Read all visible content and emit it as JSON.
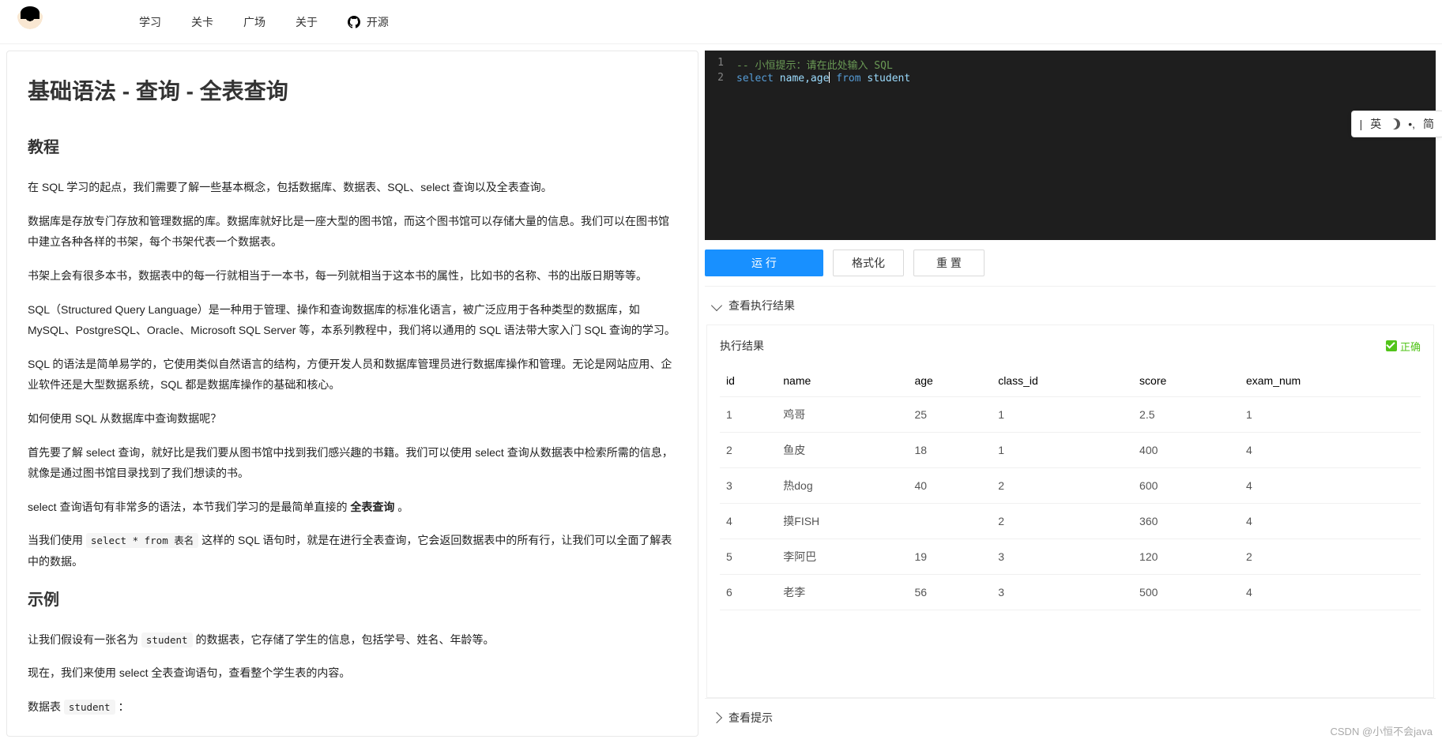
{
  "nav": {
    "items": [
      "学习",
      "关卡",
      "广场",
      "关于"
    ],
    "opensource": "开源"
  },
  "article": {
    "title": "基础语法 - 查询 - 全表查询",
    "h_tutorial": "教程",
    "p1": "在 SQL 学习的起点，我们需要了解一些基本概念，包括数据库、数据表、SQL、select 查询以及全表查询。",
    "p2": "数据库是存放专门存放和管理数据的库。数据库就好比是一座大型的图书馆，而这个图书馆可以存储大量的信息。我们可以在图书馆中建立各种各样的书架，每个书架代表一个数据表。",
    "p3": "书架上会有很多本书，数据表中的每一行就相当于一本书，每一列就相当于这本书的属性，比如书的名称、书的出版日期等等。",
    "p4": "SQL（Structured Query Language）是一种用于管理、操作和查询数据库的标准化语言，被广泛应用于各种类型的数据库，如 MySQL、PostgreSQL、Oracle、Microsoft SQL Server 等，本系列教程中，我们将以通用的 SQL 语法带大家入门 SQL 查询的学习。",
    "p5": "SQL 的语法是简单易学的，它使用类似自然语言的结构，方便开发人员和数据库管理员进行数据库操作和管理。无论是网站应用、企业软件还是大型数据系统，SQL 都是数据库操作的基础和核心。",
    "p6": "如何使用 SQL 从数据库中查询数据呢？",
    "p7": "首先要了解 select 查询，就好比是我们要从图书馆中找到我们感兴趣的书籍。我们可以使用 select 查询从数据表中检索所需的信息，就像是通过图书馆目录找到了我们想读的书。",
    "p8_pre": "select 查询语句有非常多的语法，本节我们学习的是最简单直接的 ",
    "p8_bold": "全表查询",
    "p8_post": " 。",
    "p9_pre": "当我们使用 ",
    "p9_code": "select * from 表名",
    "p9_post": " 这样的 SQL 语句时，就是在进行全表查询，它会返回数据表中的所有行，让我们可以全面了解表中的数据。",
    "h_example": "示例",
    "p10_pre": "让我们假设有一张名为 ",
    "p10_code": "student",
    "p10_post": " 的数据表，它存储了学生的信息，包括学号、姓名、年龄等。",
    "p11": "现在，我们来使用 select 全表查询语句，查看整个学生表的内容。",
    "p12_pre": "数据表 ",
    "p12_code": "student",
    "p12_post": " ："
  },
  "editor": {
    "line1_num": "1",
    "line1_prefix": "-- ",
    "line1_text": "小恒提示：请在此处输入 SQL",
    "line2_num": "2",
    "kw_select": "select",
    "ids": " name,age",
    "kw_from": " from ",
    "tbl": "student"
  },
  "toolbar": {
    "run": "运 行",
    "format": "格式化",
    "reset": "重 置"
  },
  "collapse": {
    "result_header": "查看执行结果",
    "hint_header": "查看提示"
  },
  "result": {
    "title": "执行结果",
    "ok": "正确",
    "headers": [
      "id",
      "name",
      "age",
      "class_id",
      "score",
      "exam_num"
    ],
    "rows": [
      [
        "1",
        "鸡哥",
        "25",
        "1",
        "2.5",
        "1"
      ],
      [
        "2",
        "鱼皮",
        "18",
        "1",
        "400",
        "4"
      ],
      [
        "3",
        "热dog",
        "40",
        "2",
        "600",
        "4"
      ],
      [
        "4",
        "摸FISH",
        "",
        "2",
        "360",
        "4"
      ],
      [
        "5",
        "李阿巴",
        "19",
        "3",
        "120",
        "2"
      ],
      [
        "6",
        "老李",
        "56",
        "3",
        "500",
        "4"
      ]
    ]
  },
  "ime": {
    "a": "|",
    "b": "英",
    "c": "•,",
    "d": "简"
  },
  "watermark": "CSDN @小恒不会java"
}
